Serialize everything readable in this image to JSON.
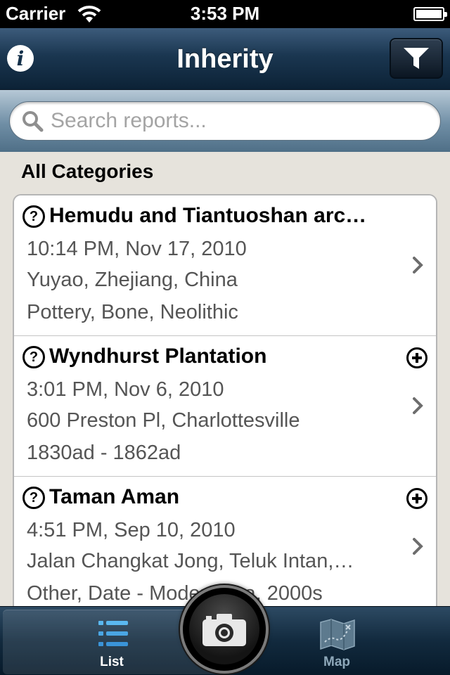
{
  "status_bar": {
    "carrier": "Carrier",
    "time": "3:53 PM"
  },
  "nav": {
    "title": "Inherity",
    "info_icon": "info-icon",
    "filter_icon": "filter-icon"
  },
  "search": {
    "placeholder": "Search reports...",
    "value": ""
  },
  "section_header": "All Categories",
  "reports": [
    {
      "title": "Hemudu and Tiantuoshan arc…",
      "datetime": "10:14 PM, Nov 17, 2010",
      "location": "Yuyao, Zhejiang, China",
      "tags": "Pottery, Bone, Neolithic",
      "has_add": false
    },
    {
      "title": "Wyndhurst Plantation",
      "datetime": "3:01 PM, Nov 6, 2010",
      "location": "600 Preston Pl, Charlottesville",
      "tags": "1830ad - 1862ad",
      "has_add": true
    },
    {
      "title": "Taman Aman",
      "datetime": "4:51 PM, Sep 10, 2010",
      "location": "Jalan Changkat Jong, Teluk Intan,…",
      "tags": "Other, Date - Modern Era, 2000s",
      "has_add": true
    }
  ],
  "tab_bar": {
    "list_label": "List",
    "map_label": "Map",
    "selected": "List"
  },
  "colors": {
    "nav_dark": "#0c2236",
    "search_bar": "#6f8ea5",
    "background": "#e6e3dc",
    "detail_text": "#555555",
    "tab_inactive": "#8ea8ba"
  }
}
